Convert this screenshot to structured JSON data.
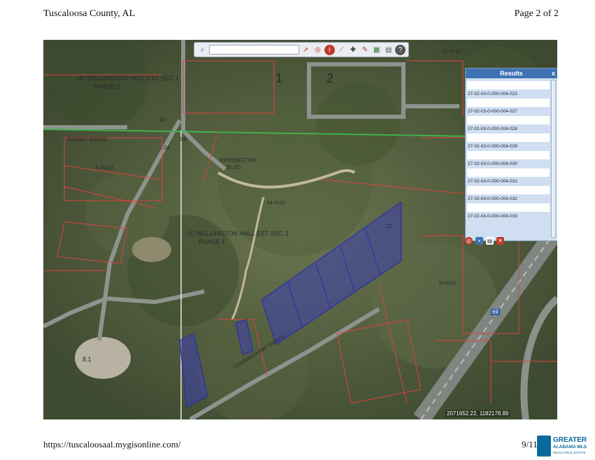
{
  "header": {
    "left": "Tuscaloosa County, AL",
    "right": "Page 2 of 2"
  },
  "footer": {
    "url": "https://tuscaloosaal.mygisonline.com/",
    "date": "9/11"
  },
  "toolbar": {
    "search_value": "",
    "icons": [
      "search-icon",
      "pointer-icon",
      "identify-icon",
      "id-icon",
      "measure-icon",
      "xy-icon",
      "draw-icon",
      "layers-icon",
      "print-icon",
      "help-icon"
    ]
  },
  "results": {
    "title": "Results",
    "close_glyph": "x",
    "items": [
      "27-02-03-0-000-004-023",
      "27-02-03-0-000-004-027",
      "27-02-03-0-000-004-028",
      "27-02-03-0-000-004-029",
      "27-02-03-0-000-004-030",
      "27-02-03-0-000-004-031",
      "27-02-03-0-000-004-032",
      "27-02-03-0-000-004-033"
    ]
  },
  "map_labels": {
    "subdivision_top": "(4) WELLINGTON HALL EST SEC 1",
    "phase_top": "PHASE 1",
    "subdivision_mid": "(4) WELLINGTON HALL EST SEC 1",
    "phase_mid": "PHASE 1",
    "rabbit_ridge": "RABBIT RIDGE",
    "kensington": "KENSINGTON",
    "blvd": "BLVD",
    "road_lower": "CUNNINGHAM FARMS",
    "acreage_top_right": "11 Ac(c)",
    "acreage_left": "5 Ac(c)",
    "acreage_mid": "64 Ac(c)",
    "acreage_right": "10 Ac(c)",
    "lot_1": "1",
    "lot_2": "2",
    "num_93": "93",
    "num_04": "04",
    "num_09": "09",
    "num_22": "22",
    "num_81": "8.1",
    "route": "69"
  },
  "coordinates": "2071652.22, 1182178.89",
  "logo": {
    "line1": "GREATER",
    "line2": "ALABAMA MLS",
    "line3": "REACH REAL ESTATE"
  },
  "colors": {
    "parcel_line": "#e0413f",
    "highlight_parcel": "#3c3fb0",
    "county_line": "#3fb24a",
    "results_header": "#3f74b4"
  }
}
